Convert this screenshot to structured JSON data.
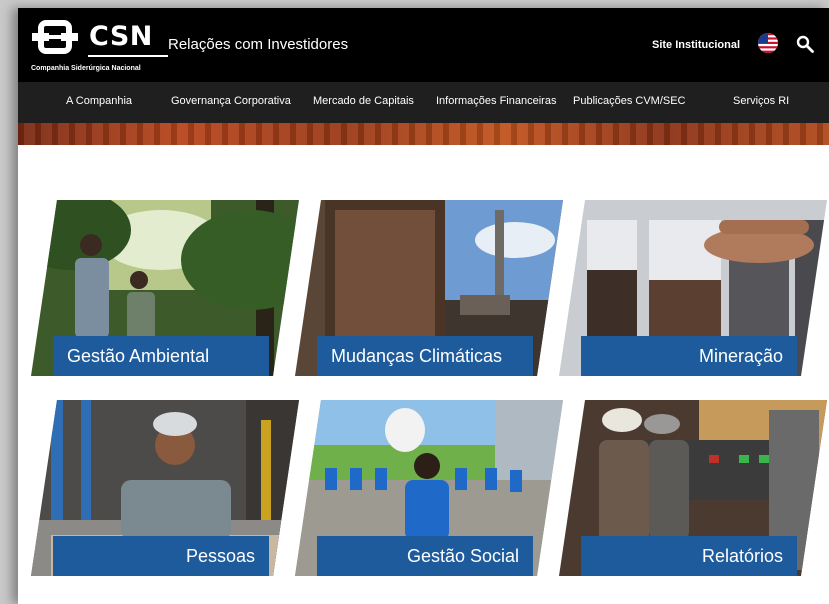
{
  "header": {
    "logo_text": "CSN",
    "logo_subtitle": "Companhia Siderúrgica Nacional",
    "title": "Relações com Investidores",
    "site_link": "Site Institucional"
  },
  "nav": {
    "items": [
      {
        "label": "A Companhia"
      },
      {
        "label": "Governança Corporativa"
      },
      {
        "label": "Mercado de Capitais"
      },
      {
        "label": "Informações Financeiras"
      },
      {
        "label": "Publicações CVM/SEC"
      },
      {
        "label": "Serviços RI"
      }
    ]
  },
  "tiles": [
    {
      "label": "Gestão Ambiental"
    },
    {
      "label": "Mudanças Climáticas"
    },
    {
      "label": "Mineração"
    },
    {
      "label": "Pessoas"
    },
    {
      "label": "Gestão Social"
    },
    {
      "label": "Relatórios"
    }
  ],
  "colors": {
    "header_bg": "#000000",
    "nav_bg": "#1f1f1f",
    "label_bg": "#1e5b9c"
  },
  "icons": {
    "logo": "csn-logo-icon",
    "flag": "us-flag-icon",
    "search": "search-icon"
  }
}
